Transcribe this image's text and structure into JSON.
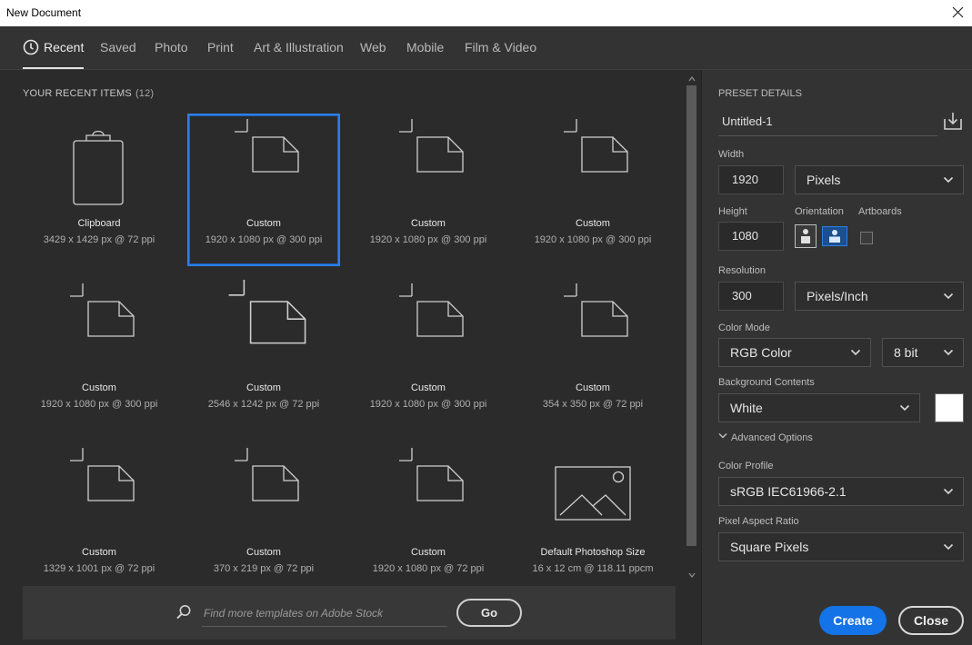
{
  "window": {
    "title": "New Document"
  },
  "tabs": [
    {
      "label": "Recent",
      "active": true
    },
    {
      "label": "Saved"
    },
    {
      "label": "Photo"
    },
    {
      "label": "Print"
    },
    {
      "label": "Art & Illustration"
    },
    {
      "label": "Web"
    },
    {
      "label": "Mobile"
    },
    {
      "label": "Film & Video"
    }
  ],
  "recent": {
    "heading": "YOUR RECENT ITEMS",
    "count": "(12)",
    "items": [
      {
        "name": "Clipboard",
        "dims": "3429 x 1429 px @ 72 ppi",
        "icon": "clipboard-icon"
      },
      {
        "name": "Custom",
        "dims": "1920 x 1080 px @ 300 ppi",
        "icon": "custom-doc-icon",
        "selected": true
      },
      {
        "name": "Custom",
        "dims": "1920 x 1080 px @ 300 ppi",
        "icon": "custom-doc-icon"
      },
      {
        "name": "Custom",
        "dims": "1920 x 1080 px @ 300 ppi",
        "icon": "custom-doc-icon"
      },
      {
        "name": "Custom",
        "dims": "1920 x 1080 px @ 300 ppi",
        "icon": "custom-doc-icon"
      },
      {
        "name": "Custom",
        "dims": "2546 x 1242 px @ 72 ppi",
        "icon": "custom-doc-icon"
      },
      {
        "name": "Custom",
        "dims": "1920 x 1080 px @ 300 ppi",
        "icon": "custom-doc-icon"
      },
      {
        "name": "Custom",
        "dims": "354 x 350 px @ 72 ppi",
        "icon": "custom-doc-icon"
      },
      {
        "name": "Custom",
        "dims": "1329 x 1001 px @ 72 ppi",
        "icon": "custom-doc-icon"
      },
      {
        "name": "Custom",
        "dims": "370 x 219 px @ 72 ppi",
        "icon": "custom-doc-icon"
      },
      {
        "name": "Custom",
        "dims": "1920 x 1080 px @ 72 ppi",
        "icon": "custom-doc-icon"
      },
      {
        "name": "Default Photoshop Size",
        "dims": "16 x 12 cm @ 118.11 ppcm",
        "icon": "image-icon"
      }
    ]
  },
  "search": {
    "placeholder": "Find more templates on Adobe Stock",
    "go_label": "Go"
  },
  "preset": {
    "heading": "PRESET DETAILS",
    "doc_name": "Untitled-1",
    "width_label": "Width",
    "width_value": "1920",
    "width_unit": "Pixels",
    "height_label": "Height",
    "height_value": "1080",
    "orientation_label": "Orientation",
    "artboards_label": "Artboards",
    "resolution_label": "Resolution",
    "resolution_value": "300",
    "resolution_unit": "Pixels/Inch",
    "color_mode_label": "Color Mode",
    "color_mode": "RGB Color",
    "bit_depth": "8 bit",
    "bg_label": "Background Contents",
    "bg_value": "White",
    "bg_color": "#ffffff",
    "advanced_label": "Advanced Options",
    "profile_label": "Color Profile",
    "profile_value": "sRGB IEC61966-2.1",
    "aspect_label": "Pixel Aspect Ratio",
    "aspect_value": "Square Pixels"
  },
  "actions": {
    "create": "Create",
    "close": "Close"
  },
  "colors": {
    "accent": "#1473e6",
    "selection": "#2d7ee6",
    "bg": "#2b2b2b",
    "panel": "#333333"
  }
}
